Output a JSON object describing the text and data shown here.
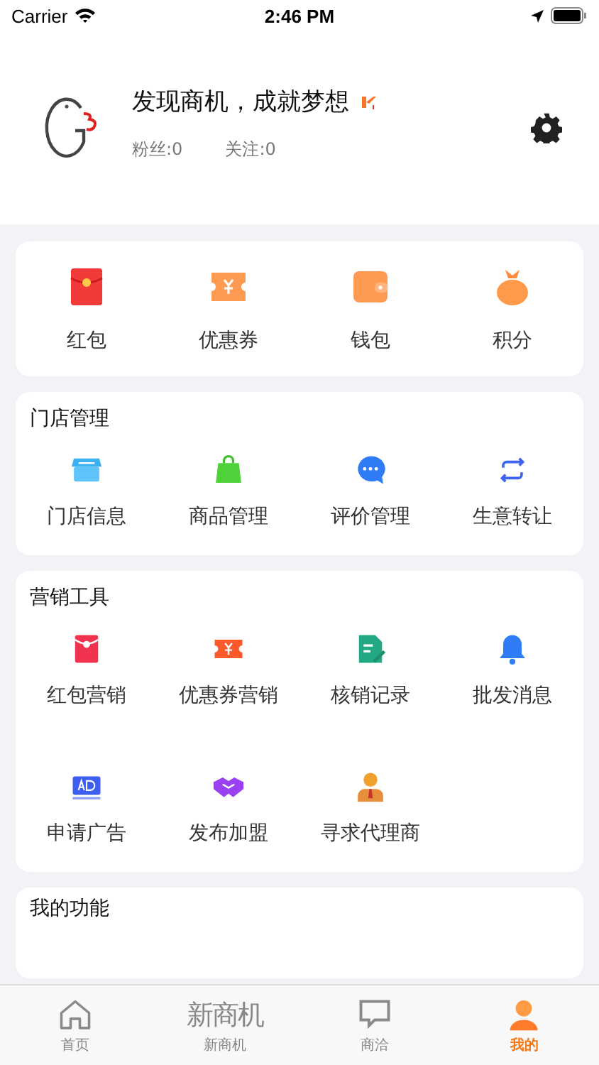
{
  "status_bar": {
    "carrier": "Carrier",
    "time": "2:46 PM"
  },
  "profile": {
    "name": "发现商机，成就梦想",
    "fans": "粉丝:0",
    "following": "关注:0"
  },
  "wallet": {
    "items": [
      {
        "label": "红包"
      },
      {
        "label": "优惠券"
      },
      {
        "label": "钱包"
      },
      {
        "label": "积分"
      }
    ]
  },
  "sections": [
    {
      "title": "门店管理",
      "items": [
        {
          "label": "门店信息"
        },
        {
          "label": "商品管理"
        },
        {
          "label": "评价管理"
        },
        {
          "label": "生意转让"
        }
      ]
    },
    {
      "title": "营销工具",
      "items": [
        {
          "label": "红包营销"
        },
        {
          "label": "优惠券营销"
        },
        {
          "label": "核销记录"
        },
        {
          "label": "批发消息"
        },
        {
          "label": "申请广告"
        },
        {
          "label": "发布加盟"
        },
        {
          "label": "寻求代理商"
        }
      ]
    },
    {
      "title": "我的功能"
    }
  ],
  "tab_bar": [
    {
      "label": "首页",
      "selected": false
    },
    {
      "label": "新商机",
      "logo_text": "新商机",
      "selected": false
    },
    {
      "label": "商洽",
      "selected": false
    },
    {
      "label": "我的",
      "selected": true
    }
  ]
}
